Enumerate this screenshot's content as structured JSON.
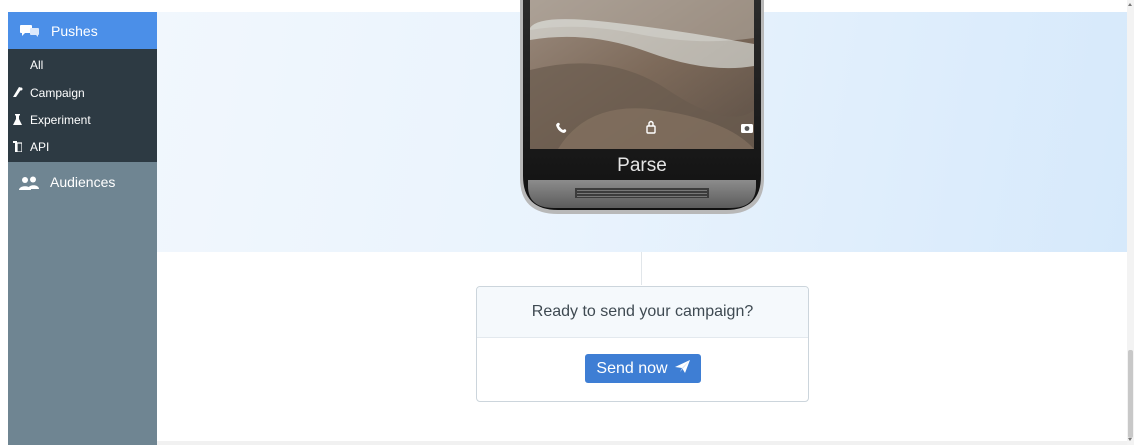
{
  "sidebar": {
    "active": {
      "label": "Pushes",
      "icon": "chat-bubbles-icon"
    },
    "subitems": [
      {
        "label": "All",
        "icon": ""
      },
      {
        "label": "Campaign",
        "icon": "megaphone-icon"
      },
      {
        "label": "Experiment",
        "icon": "flask-icon"
      },
      {
        "label": "API",
        "icon": "mobile-device-icon"
      }
    ],
    "items": [
      {
        "label": "Audiences",
        "icon": "people-icon"
      }
    ]
  },
  "phone": {
    "brand": "Parse",
    "icons": [
      "phone-icon",
      "lock-icon",
      "camera-icon"
    ]
  },
  "card": {
    "prompt": "Ready to send your campaign?",
    "button_label": "Send now",
    "button_icon": "paper-plane-icon"
  },
  "colors": {
    "sidebar_bg": "#6f8592",
    "subnav_bg": "#2d3a43",
    "active_nav": "#4b8fe8",
    "button": "#3e7ed4",
    "hero_bg": "#e9f3fd"
  }
}
